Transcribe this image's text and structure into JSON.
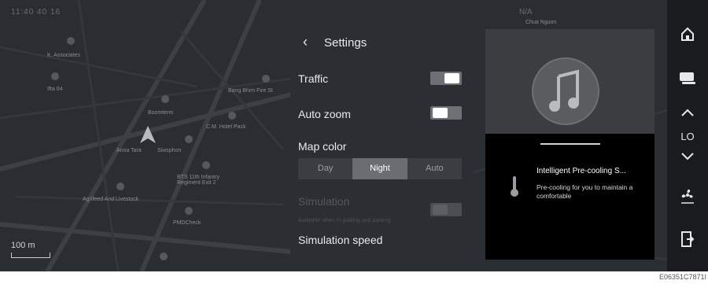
{
  "map": {
    "status_left": "11:40 40 16",
    "status_right": "N/A",
    "scale_label": "100 m",
    "poi_labels": [
      "K. Associates",
      "Ifta 04",
      "Bang Bhim Fire St",
      "Boomterm",
      "C.M. Hotel Pack",
      "Anna Tara",
      "Siwsphon",
      "BTS 11th Infantry Regiment Exit 2",
      "Agrifeed And Livestock",
      "PMDCheck",
      "Chua Nguon"
    ]
  },
  "settings": {
    "back_glyph": "‹",
    "title": "Settings",
    "traffic_label": "Traffic",
    "traffic_on": true,
    "auto_zoom_label": "Auto zoom",
    "auto_zoom_on": false,
    "map_color_label": "Map color",
    "map_color_options": [
      "Day",
      "Night",
      "Auto"
    ],
    "map_color_selected": "Night",
    "simulation_label": "Simulation",
    "simulation_hint": "Available when in guiding and parking",
    "simulation_speed_label": "Simulation speed"
  },
  "media_card": {
    "notification_title": "Intelligent Pre-cooling S...",
    "notification_body": "Pre-cooling for you to maintain a comfortable"
  },
  "rail": {
    "home_icon": "home-icon",
    "display_icon": "display-icon",
    "fan_level": "LO",
    "fan_icon": "fan-icon",
    "door_icon": "door-exit-icon"
  },
  "footer_code": "E06351C7871I"
}
